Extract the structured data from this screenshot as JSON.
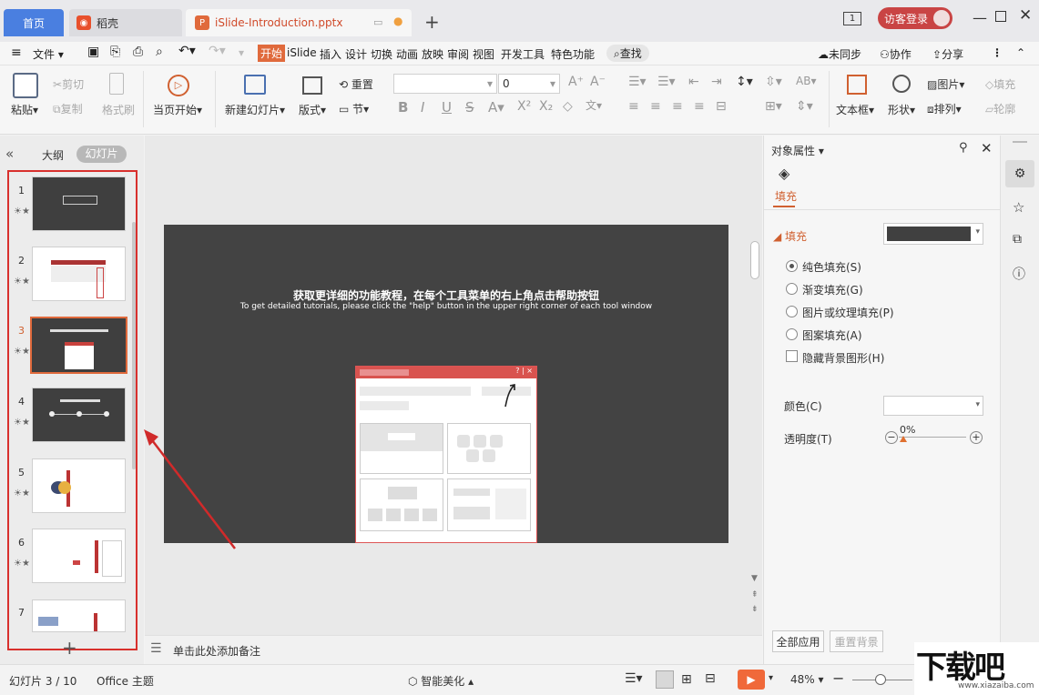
{
  "tabs": {
    "home": "首页",
    "daoke": "稻壳",
    "file": "iSlide-Introduction.pptx"
  },
  "titlebar": {
    "window_count": "1",
    "login": "访客登录"
  },
  "menu": {
    "file": "文件",
    "items": [
      "开始",
      "iSlide",
      "插入",
      "设计",
      "切换",
      "动画",
      "放映",
      "审阅",
      "视图",
      "开发工具",
      "特色功能"
    ],
    "search": "查找",
    "sync": "未同步",
    "collab": "协作",
    "share": "分享"
  },
  "ribbon": {
    "paste": "粘贴",
    "cut": "剪切",
    "copy": "复制",
    "format_painter": "格式刷",
    "start_from": "当页开始",
    "new_slide": "新建幻灯片",
    "layout": "版式",
    "reset": "重置",
    "section": "节",
    "font_name": "",
    "font_size": "0",
    "textbox": "文本框",
    "shape": "形状",
    "picture": "图片",
    "arrange": "排列",
    "fill": "填充",
    "outline": "轮廓"
  },
  "left_panel": {
    "outline_tab": "大纲",
    "slides_tab": "幻灯片",
    "slide_numbers": [
      "1",
      "2",
      "3",
      "4",
      "5",
      "6",
      "7"
    ],
    "selected": "3"
  },
  "slide": {
    "title_cn": "获取更详细的功能教程，在每个工具菜单的右上角点击帮助按钮",
    "title_en": "To get detailed tutorials, please click the \"help\" button in the upper right corner of each tool window",
    "mini_window_buttons": "? | ×"
  },
  "notes": {
    "placeholder": "单击此处添加备注"
  },
  "props": {
    "title": "对象属性",
    "tab_fill": "填充",
    "section_fill": "填充",
    "fill_color": "#404040",
    "options": [
      "纯色填充(S)",
      "渐变填充(G)",
      "图片或纹理填充(P)",
      "图案填充(A)"
    ],
    "selected_option": "纯色填充(S)",
    "hide_bg": "隐藏背景图形(H)",
    "color_label": "颜色(C)",
    "transparency_label": "透明度(T)",
    "transparency_value": "0%",
    "apply_all": "全部应用",
    "reset_bg": "重置背景"
  },
  "status": {
    "slide_info": "幻灯片 3 / 10",
    "theme": "Office 主题",
    "beautify": "智能美化",
    "zoom": "48%"
  },
  "colors": {
    "accent_red": "#c9423d",
    "brand_orange": "#e06a3c",
    "tab_blue": "#4a7fe0",
    "play_orange": "#f0693a"
  },
  "watermark": "下载吧 www.xiazaiba.com"
}
